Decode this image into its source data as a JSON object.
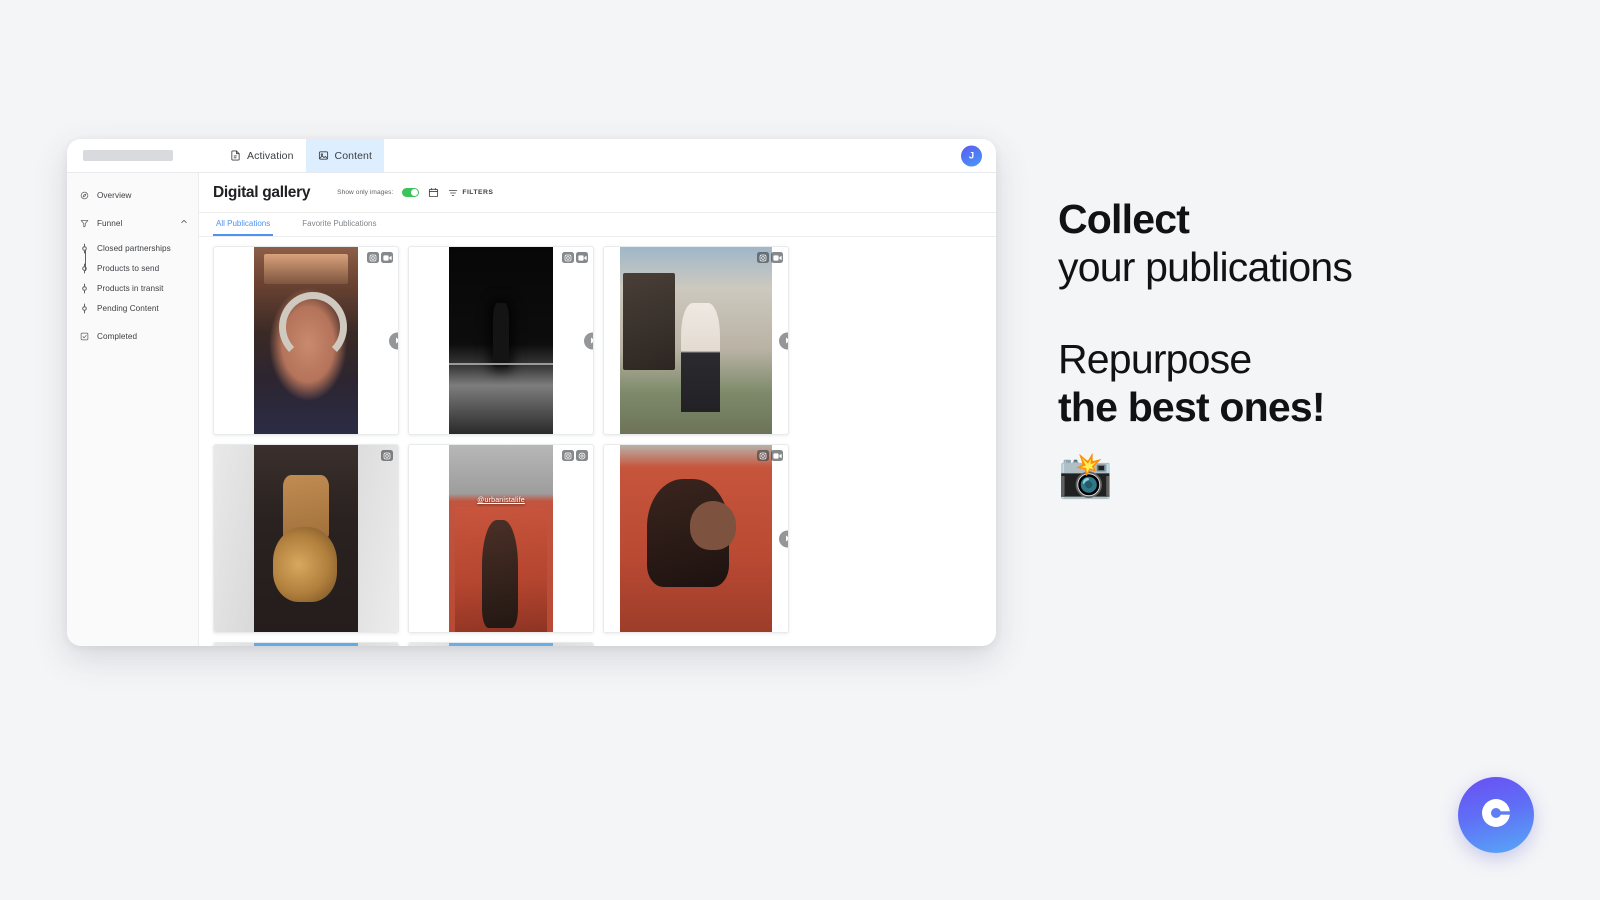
{
  "window": {
    "top_bar": {
      "brand_placeholder": "",
      "tabs": [
        {
          "label": "Activation",
          "icon": "document-icon",
          "active": false
        },
        {
          "label": "Content",
          "icon": "image-icon",
          "active": true
        }
      ],
      "avatar_initial": "J"
    }
  },
  "sidebar": {
    "items": [
      {
        "label": "Overview",
        "icon": "compass-icon",
        "level": "top"
      },
      {
        "label": "Funnel",
        "icon": "funnel-icon",
        "level": "top",
        "expanded": true,
        "chevron": "chevron-up-icon"
      },
      {
        "label": "Closed partnerships",
        "icon": "node-dot-icon",
        "level": "sub"
      },
      {
        "label": "Products to send",
        "icon": "node-dot-icon",
        "level": "sub"
      },
      {
        "label": "Products in transit",
        "icon": "node-dot-icon",
        "level": "sub"
      },
      {
        "label": "Pending Content",
        "icon": "node-dot-icon",
        "level": "sub"
      },
      {
        "label": "Completed",
        "icon": "checkbox-icon",
        "level": "top"
      }
    ]
  },
  "main": {
    "page_title": "Digital gallery",
    "toolbar": {
      "toggle_label": "Show only images:",
      "toggle_on": true,
      "calendar_icon": "calendar-icon",
      "filters_icon": "filter-icon",
      "filters_label": "FILTERS"
    },
    "tabs": [
      {
        "label": "All Publications",
        "active": true
      },
      {
        "label": "Favorite Publications",
        "active": false
      }
    ],
    "cards": [
      {
        "id": 1,
        "art": "ph-1",
        "width": "narrow",
        "letterbox": false,
        "badges": [
          "instagram-icon",
          "video-icon"
        ],
        "next_arrow": true,
        "handle": "",
        "sticker": ""
      },
      {
        "id": 2,
        "art": "ph-2",
        "width": "narrow",
        "letterbox": false,
        "badges": [
          "instagram-icon",
          "video-icon"
        ],
        "next_arrow": true,
        "handle": "",
        "sticker": ""
      },
      {
        "id": 3,
        "art": "ph-3",
        "width": "wide",
        "letterbox": false,
        "badges": [
          "instagram-icon",
          "video-icon"
        ],
        "next_arrow": true,
        "handle": "",
        "sticker": ""
      },
      {
        "id": 4,
        "art": "ph-4",
        "width": "narrow",
        "letterbox": true,
        "badges": [
          "instagram-icon"
        ],
        "next_arrow": false,
        "handle": "",
        "sticker": ""
      },
      {
        "id": 5,
        "art": "ph-5",
        "width": "narrow",
        "letterbox": false,
        "badges": [
          "instagram-icon",
          "story-icon"
        ],
        "next_arrow": false,
        "handle": "@urbanistalife",
        "sticker": ""
      },
      {
        "id": 6,
        "art": "ph-6",
        "width": "wide",
        "letterbox": false,
        "badges": [
          "instagram-icon",
          "video-icon"
        ],
        "next_arrow": true,
        "handle": "",
        "sticker": ""
      },
      {
        "id": 7,
        "art": "ph-7",
        "width": "narrow",
        "letterbox": true,
        "badges": [
          "instagram-icon"
        ],
        "next_arrow": false,
        "handle": "",
        "sticker": ""
      },
      {
        "id": 8,
        "art": "ph-8",
        "width": "narrow",
        "letterbox": true,
        "badges": [
          "instagram-icon"
        ],
        "next_arrow": false,
        "handle": "",
        "sticker": "🇨🇳"
      }
    ]
  },
  "promo": {
    "line1": "Collect",
    "line2": "your publications",
    "line3": "Repurpose",
    "line4": "the best ones!",
    "emoji": "📸"
  },
  "chat": {
    "icon": "chat-launcher-icon"
  },
  "colors": {
    "page_background": "#f4f5f7",
    "accent_blue": "#4f93f0",
    "toggle_green": "#3cc35b",
    "active_tab_background": "#ddeeff",
    "avatar_gradient_start": "#5b5bf0",
    "avatar_gradient_end": "#4a9bf7",
    "chat_gradient_start": "#6b4ef5",
    "chat_gradient_end": "#57a9f7"
  }
}
